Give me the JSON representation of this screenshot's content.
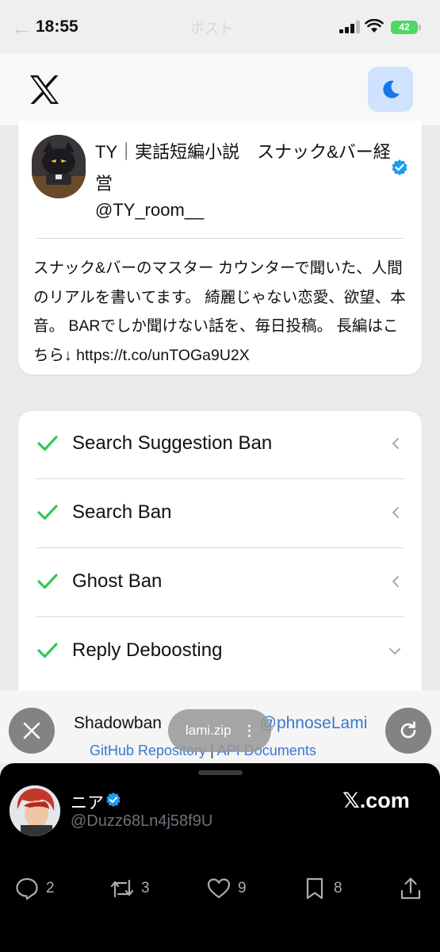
{
  "status_bar": {
    "time": "18:55",
    "page_title_ghost": "ポスト",
    "battery": "42"
  },
  "header": {
    "logo": "x-logo-icon",
    "theme_toggle_icon": "moon-icon"
  },
  "profile": {
    "name": "TY｜実話短編小説　スナック&バー経営",
    "handle": "@TY_room__",
    "bio": "スナック&バーのマスター カウンターで聞いた、人間のリアルを書いてます。 綺麗じゃない恋愛、欲望、本音。 BARでしか聞けない話を、毎日投稿。 長編はこちら↓ https://t.co/unTOGa9U2X"
  },
  "checks": [
    {
      "label": "Search Suggestion Ban",
      "status": "ok",
      "expanded": false
    },
    {
      "label": "Search Ban",
      "status": "ok",
      "expanded": false
    },
    {
      "label": "Ghost Ban",
      "status": "ok",
      "expanded": false
    },
    {
      "label": "Reply Deboosting",
      "status": "ok",
      "expanded": true
    }
  ],
  "footer": {
    "prefix": "Shadowban",
    "author_link": "@phnoseLami",
    "repo_link": "GitHub Repository",
    "separator": "|",
    "docs_link": "API Documents"
  },
  "download": {
    "filename": "lami.zip"
  },
  "tweet": {
    "name": "ニア",
    "handle": "@Duzz68Ln4j58f9U",
    "site_mark": "𝕏",
    "site_suffix": ".com",
    "replies": "2",
    "retweets": "3",
    "likes": "9",
    "bookmarks": "8"
  },
  "colors": {
    "accent_blue": "#3a78d0",
    "check_green": "#34c759",
    "verified_blue": "#1d9bf0"
  }
}
